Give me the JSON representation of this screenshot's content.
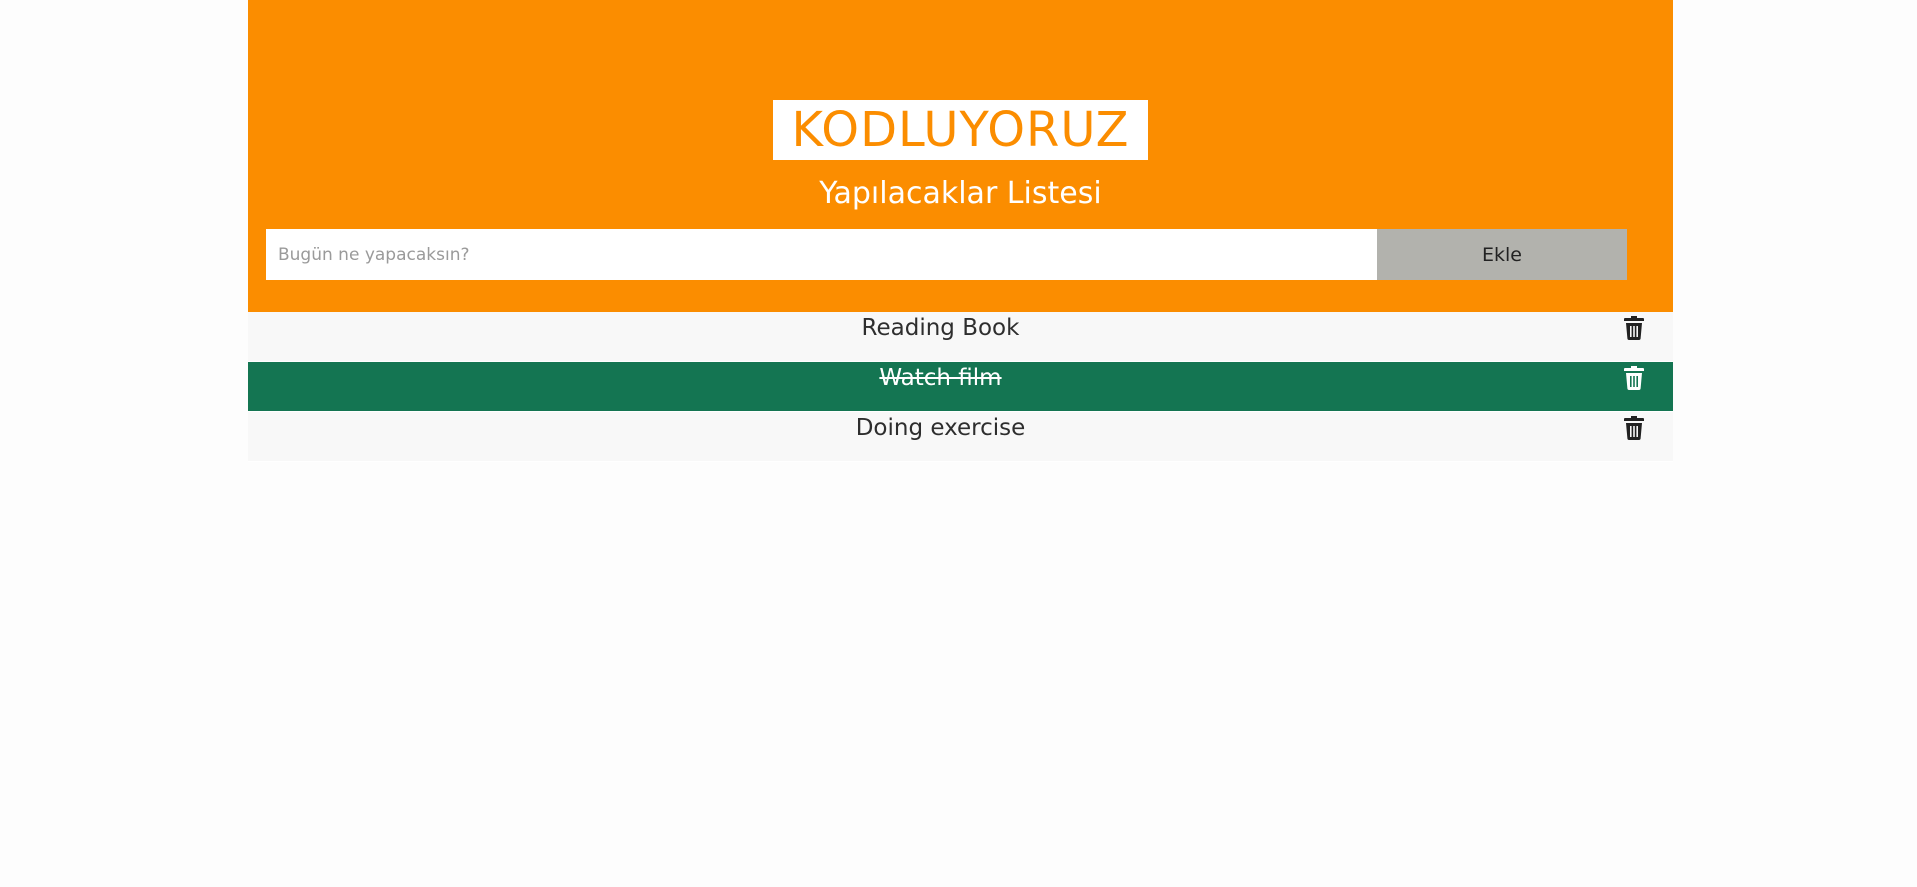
{
  "header": {
    "brand": "KODLUYORUZ",
    "subtitle": "Yapılacaklar Listesi",
    "colors": {
      "accent": "#fb8d00",
      "done": "#147552",
      "button": "#b2b2ad"
    }
  },
  "form": {
    "input_value": "",
    "input_placeholder": "Bugün ne yapacaksın?",
    "add_label": "Ekle"
  },
  "todos": [
    {
      "text": "Reading Book",
      "done": false,
      "icon": "trash-icon"
    },
    {
      "text": "Watch film",
      "done": true,
      "icon": "trash-icon"
    },
    {
      "text": "Doing exercise",
      "done": false,
      "icon": "trash-icon"
    }
  ]
}
